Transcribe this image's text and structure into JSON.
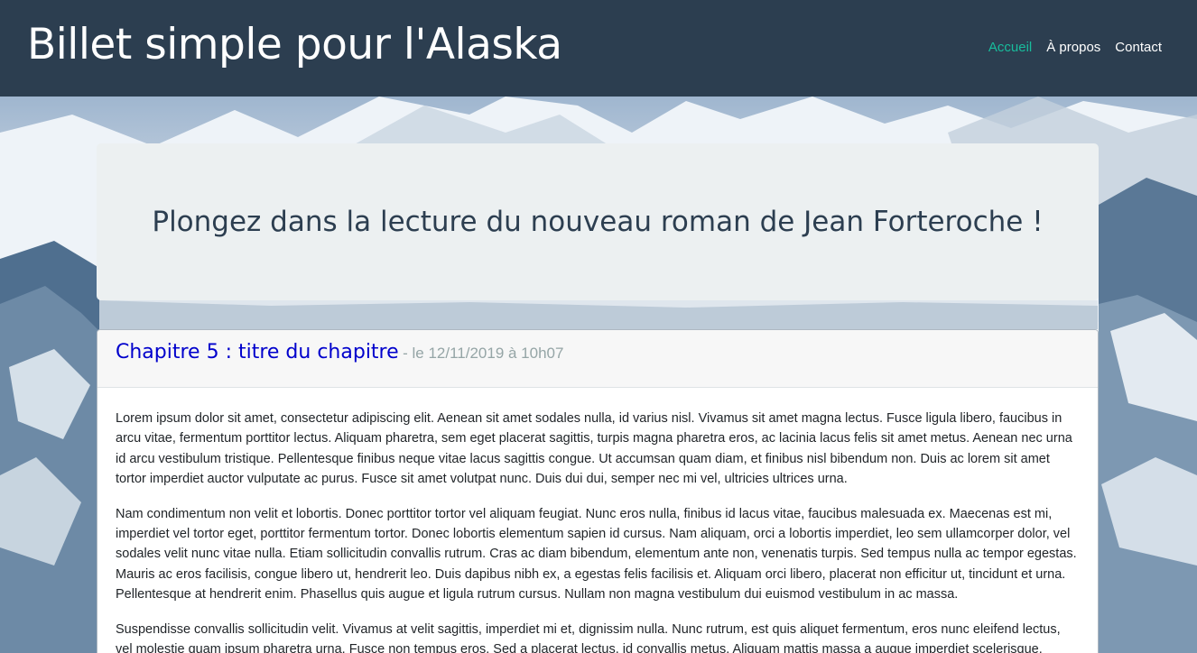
{
  "header": {
    "brand": "Billet simple pour l'Alaska",
    "nav": [
      {
        "label": "Accueil",
        "active": true
      },
      {
        "label": "À propos",
        "active": false
      },
      {
        "label": "Contact",
        "active": false
      }
    ]
  },
  "jumbotron": {
    "title": "Plongez dans la lecture du nouveau roman de Jean Forteroche !"
  },
  "chapter": {
    "title": "Chapitre 5 : titre du chapitre",
    "date": "- le 12/11/2019 à 10h07",
    "paragraphs": [
      "Lorem ipsum dolor sit amet, consectetur adipiscing elit. Aenean sit amet sodales nulla, id varius nisl. Vivamus sit amet magna lectus. Fusce ligula libero, faucibus in arcu vitae, fermentum porttitor lectus. Aliquam pharetra, sem eget placerat sagittis, turpis magna pharetra eros, ac lacinia lacus felis sit amet metus. Aenean nec urna id arcu vestibulum tristique. Pellentesque finibus neque vitae lacus sagittis congue. Ut accumsan quam diam, et finibus nisl bibendum non. Duis ac lorem sit amet tortor imperdiet auctor vulputate ac purus. Fusce sit amet volutpat nunc. Duis dui dui, semper nec mi vel, ultricies ultrices urna.",
      "Nam condimentum non velit et lobortis. Donec porttitor tortor vel aliquam feugiat. Nunc eros nulla, finibus id lacus vitae, faucibus malesuada ex. Maecenas est mi, imperdiet vel tortor eget, porttitor fermentum tortor. Donec lobortis elementum sapien id cursus. Nam aliquam, orci a lobortis imperdiet, leo sem ullamcorper dolor, vel sodales velit nunc vitae nulla. Etiam sollicitudin convallis rutrum. Cras ac diam bibendum, elementum ante non, venenatis turpis. Sed tempus nulla ac tempor egestas. Mauris ac eros facilisis, congue libero ut, hendrerit leo. Duis dapibus nibh ex, a egestas felis facilisis et. Aliquam orci libero, placerat non efficitur ut, tincidunt et urna. Pellentesque at hendrerit enim. Phasellus quis augue et ligula rutrum cursus. Nullam non magna vestibulum dui euismod vestibulum in ac massa.",
      "Suspendisse convallis sollicitudin velit. Vivamus at velit sagittis, imperdiet mi et, dignissim nulla. Nunc rutrum, est quis aliquet fermentum, eros nunc eleifend lectus, vel molestie quam ipsum pharetra urna. Fusce non tempus eros. Sed a placerat lectus, id convallis metus. Aliquam mattis massa a augue imperdiet scelerisque."
    ]
  },
  "colors": {
    "navbar": "#2c3e50",
    "nav_active": "#18bc9c",
    "chapter_title": "#0000cc",
    "date": "#95a5a6",
    "jumbotron": "#ecf0f1"
  }
}
